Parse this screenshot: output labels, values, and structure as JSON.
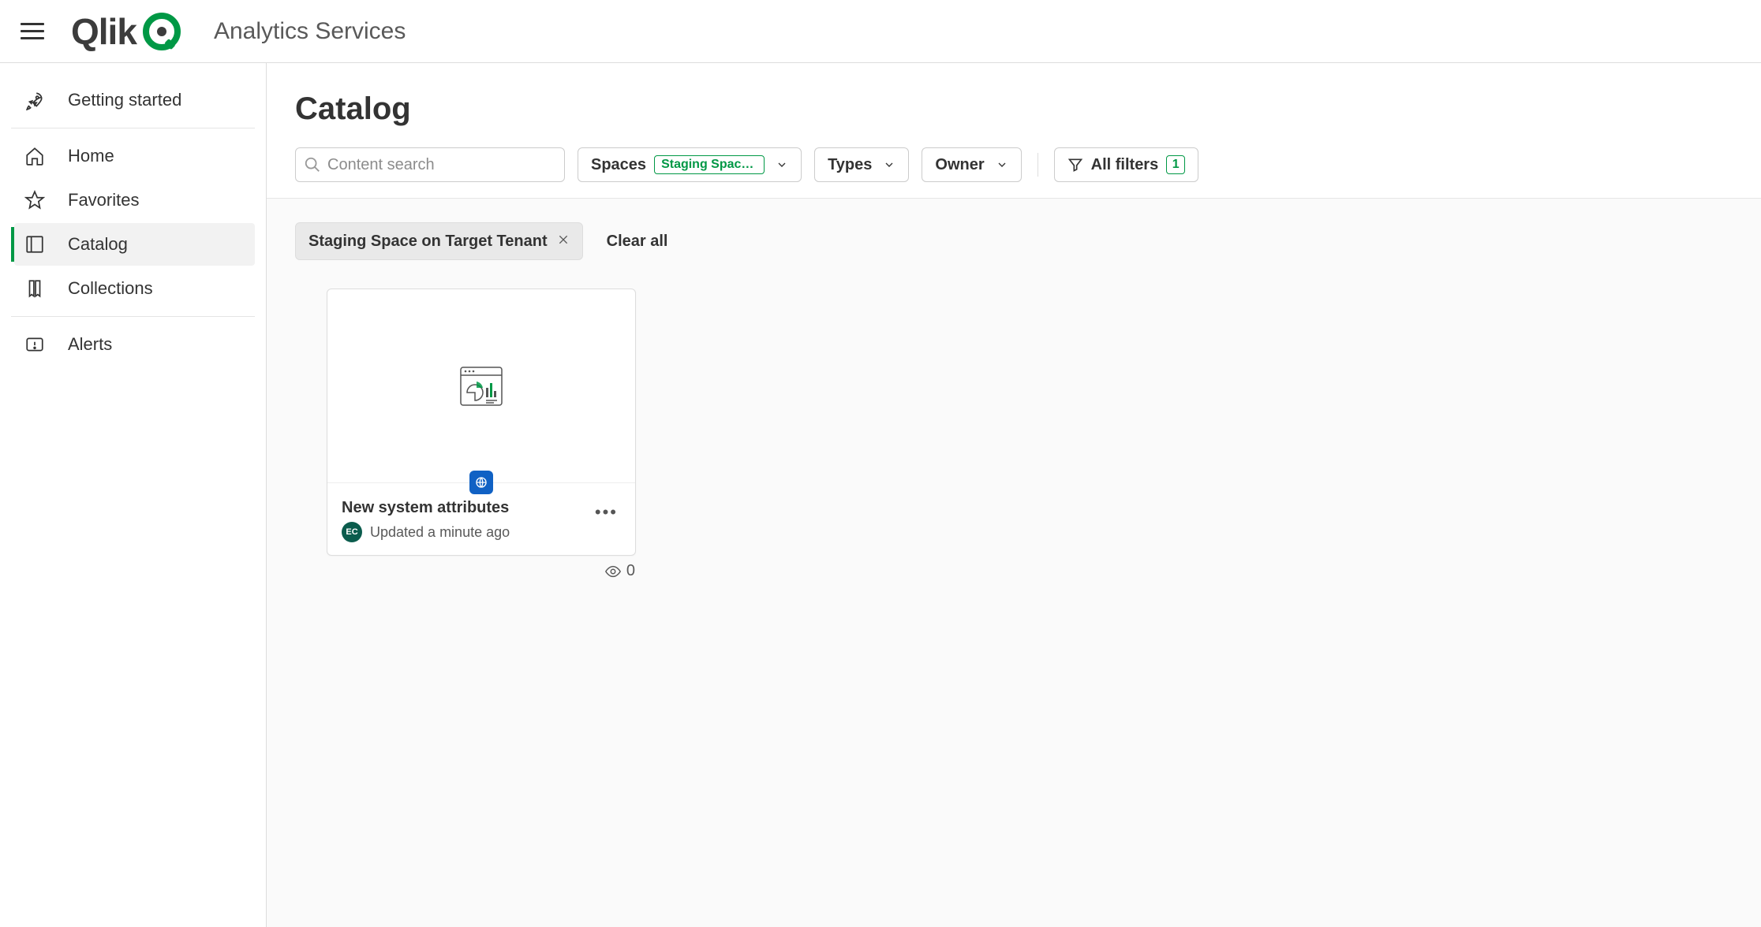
{
  "header": {
    "brand": "Qlik",
    "tenant": "Analytics Services"
  },
  "sidebar": {
    "items": [
      {
        "label": "Getting started",
        "icon": "rocket"
      },
      {
        "label": "Home",
        "icon": "home"
      },
      {
        "label": "Favorites",
        "icon": "star"
      },
      {
        "label": "Catalog",
        "icon": "catalog",
        "active": true
      },
      {
        "label": "Collections",
        "icon": "bookmark"
      },
      {
        "label": "Alerts",
        "icon": "alert"
      }
    ]
  },
  "page": {
    "title": "Catalog"
  },
  "search": {
    "placeholder": "Content search"
  },
  "filters": {
    "spaces_label": "Spaces",
    "spaces_selected": "Staging Space …",
    "types_label": "Types",
    "owner_label": "Owner",
    "allfilters_label": "All filters",
    "allfilters_count": "1"
  },
  "chips": {
    "items": [
      {
        "label": "Staging Space on Target Tenant"
      }
    ],
    "clear_label": "Clear all"
  },
  "cards": [
    {
      "title": "New system attributes",
      "owner_initials": "EC",
      "updated": "Updated a minute ago",
      "views": "0"
    }
  ]
}
